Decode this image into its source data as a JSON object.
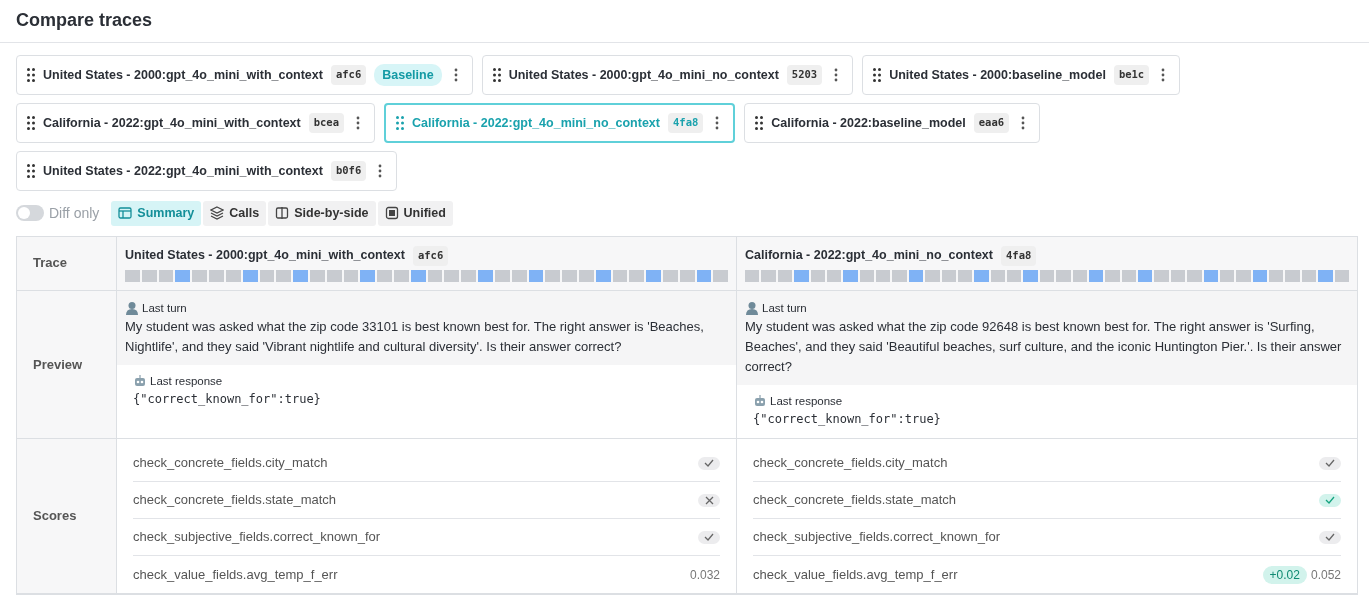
{
  "title": "Compare traces",
  "traces": [
    {
      "name": "United States - 2000:gpt_4o_mini_with_context",
      "id": "afc6",
      "badge": "Baseline",
      "selected": false
    },
    {
      "name": "United States - 2000:gpt_4o_mini_no_context",
      "id": "5203",
      "selected": false
    },
    {
      "name": "United States - 2000:baseline_model",
      "id": "be1c",
      "selected": false
    },
    {
      "name": "California - 2022:gpt_4o_mini_with_context",
      "id": "bcea",
      "selected": false
    },
    {
      "name": "California - 2022:gpt_4o_mini_no_context",
      "id": "4fa8",
      "selected": true
    },
    {
      "name": "California - 2022:baseline_model",
      "id": "eaa6",
      "selected": false
    },
    {
      "name": "United States - 2022:gpt_4o_mini_with_context",
      "id": "b0f6",
      "selected": false
    }
  ],
  "diff_toggle": {
    "label": "Diff only",
    "on": false
  },
  "views": [
    {
      "label": "Summary",
      "kind": "summary",
      "selected": true
    },
    {
      "label": "Calls",
      "kind": "calls",
      "selected": false
    },
    {
      "label": "Side-by-side",
      "kind": "side",
      "selected": false
    },
    {
      "label": "Unified",
      "kind": "unified",
      "selected": false
    }
  ],
  "row_labels": [
    "Trace",
    "Preview",
    "Scores"
  ],
  "columns": [
    {
      "name": "United States - 2000:gpt_4o_mini_with_context",
      "id": "afc6",
      "segments": [
        {
          "color": "#c8cbd0"
        },
        {
          "color": "#c8cbd0"
        },
        {
          "color": "#c8cbd0"
        },
        {
          "color": "#7fb2f5"
        },
        {
          "color": "#c8cbd0"
        },
        {
          "color": "#c8cbd0"
        },
        {
          "color": "#c8cbd0"
        },
        {
          "color": "#7fb2f5"
        },
        {
          "color": "#c8cbd0"
        },
        {
          "color": "#c8cbd0"
        },
        {
          "color": "#7fb2f5"
        },
        {
          "color": "#c8cbd0"
        },
        {
          "color": "#c8cbd0"
        },
        {
          "color": "#c8cbd0"
        },
        {
          "color": "#7fb2f5"
        },
        {
          "color": "#c8cbd0"
        },
        {
          "color": "#c8cbd0"
        },
        {
          "color": "#7fb2f5"
        },
        {
          "color": "#c8cbd0"
        },
        {
          "color": "#c8cbd0"
        },
        {
          "color": "#c8cbd0"
        },
        {
          "color": "#7fb2f5"
        },
        {
          "color": "#c8cbd0"
        },
        {
          "color": "#c8cbd0"
        },
        {
          "color": "#7fb2f5"
        },
        {
          "color": "#c8cbd0"
        },
        {
          "color": "#c8cbd0"
        },
        {
          "color": "#c8cbd0"
        },
        {
          "color": "#7fb2f5"
        },
        {
          "color": "#c8cbd0"
        },
        {
          "color": "#c8cbd0"
        },
        {
          "color": "#7fb2f5"
        },
        {
          "color": "#c8cbd0"
        },
        {
          "color": "#c8cbd0"
        },
        {
          "color": "#7fb2f5"
        },
        {
          "color": "#c8cbd0"
        }
      ],
      "turn_label": "Last turn",
      "turn_text": "My student was asked what the zip code 33101 is best known best for. The right answer is 'Beaches, Nightlife', and they said 'Vibrant nightlife and cultural diversity'. Is their answer correct?",
      "response_label": "Last response",
      "response_text": "{\"correct_known_for\":true}",
      "scores": [
        {
          "name": "check_concrete_fields.city_match",
          "kind": "bool",
          "result": true,
          "changed": false
        },
        {
          "name": "check_concrete_fields.state_match",
          "kind": "bool",
          "result": false,
          "changed": false
        },
        {
          "name": "check_subjective_fields.correct_known_for",
          "kind": "bool",
          "result": true,
          "changed": false
        },
        {
          "name": "check_value_fields.avg_temp_f_err",
          "kind": "number",
          "value": "0.032"
        }
      ]
    },
    {
      "name": "California - 2022:gpt_4o_mini_no_context",
      "id": "4fa8",
      "segments": [
        {
          "color": "#c8cbd0"
        },
        {
          "color": "#c8cbd0"
        },
        {
          "color": "#c8cbd0"
        },
        {
          "color": "#7fb2f5"
        },
        {
          "color": "#c8cbd0"
        },
        {
          "color": "#c8cbd0"
        },
        {
          "color": "#7fb2f5"
        },
        {
          "color": "#c8cbd0"
        },
        {
          "color": "#c8cbd0"
        },
        {
          "color": "#c8cbd0"
        },
        {
          "color": "#7fb2f5"
        },
        {
          "color": "#c8cbd0"
        },
        {
          "color": "#c8cbd0"
        },
        {
          "color": "#c8cbd0"
        },
        {
          "color": "#7fb2f5"
        },
        {
          "color": "#c8cbd0"
        },
        {
          "color": "#c8cbd0"
        },
        {
          "color": "#7fb2f5"
        },
        {
          "color": "#c8cbd0"
        },
        {
          "color": "#c8cbd0"
        },
        {
          "color": "#c8cbd0"
        },
        {
          "color": "#7fb2f5"
        },
        {
          "color": "#c8cbd0"
        },
        {
          "color": "#c8cbd0"
        },
        {
          "color": "#7fb2f5"
        },
        {
          "color": "#c8cbd0"
        },
        {
          "color": "#c8cbd0"
        },
        {
          "color": "#c8cbd0"
        },
        {
          "color": "#7fb2f5"
        },
        {
          "color": "#c8cbd0"
        },
        {
          "color": "#c8cbd0"
        },
        {
          "color": "#7fb2f5"
        },
        {
          "color": "#c8cbd0"
        },
        {
          "color": "#c8cbd0"
        },
        {
          "color": "#c8cbd0"
        },
        {
          "color": "#7fb2f5"
        },
        {
          "color": "#c8cbd0"
        }
      ],
      "turn_label": "Last turn",
      "turn_text": "My student was asked what the zip code 92648 is best known best for. The right answer is 'Surfing, Beaches', and they said 'Beautiful beaches, surf culture, and the iconic Huntington Pier.'. Is their answer correct?",
      "response_label": "Last response",
      "response_text": "{\"correct_known_for\":true}",
      "scores": [
        {
          "name": "check_concrete_fields.city_match",
          "kind": "bool",
          "result": true,
          "changed": false
        },
        {
          "name": "check_concrete_fields.state_match",
          "kind": "bool",
          "result": true,
          "changed": true
        },
        {
          "name": "check_subjective_fields.correct_known_for",
          "kind": "bool",
          "result": true,
          "changed": false
        },
        {
          "name": "check_value_fields.avg_temp_f_err",
          "kind": "number",
          "value": "0.052",
          "delta": "+0.02"
        }
      ]
    }
  ]
}
